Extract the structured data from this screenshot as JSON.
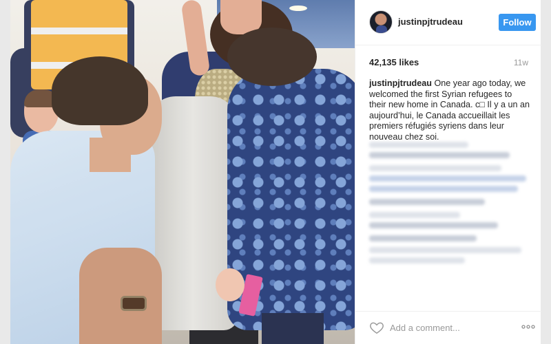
{
  "post": {
    "username": "justinpjtrudeau",
    "follow_label": "Follow",
    "likes": "42,135 likes",
    "age": "11w",
    "caption_user": "justinpjtrudeau",
    "caption_text": " One year ago today, we welcomed the first Syrian refugees to their new home in Canada. c□ Il y a un an aujourd’hui, le Canada accueillait les premiers réfugiés syriens dans leur nouveau chez soi."
  },
  "comment": {
    "placeholder": "Add a comment..."
  },
  "icons": {
    "like": "heart-outline-icon",
    "more": "more-options-icon",
    "avatar": "profile-avatar"
  },
  "colors": {
    "accent": "#3897f0",
    "text": "#262626",
    "muted": "#999999"
  }
}
